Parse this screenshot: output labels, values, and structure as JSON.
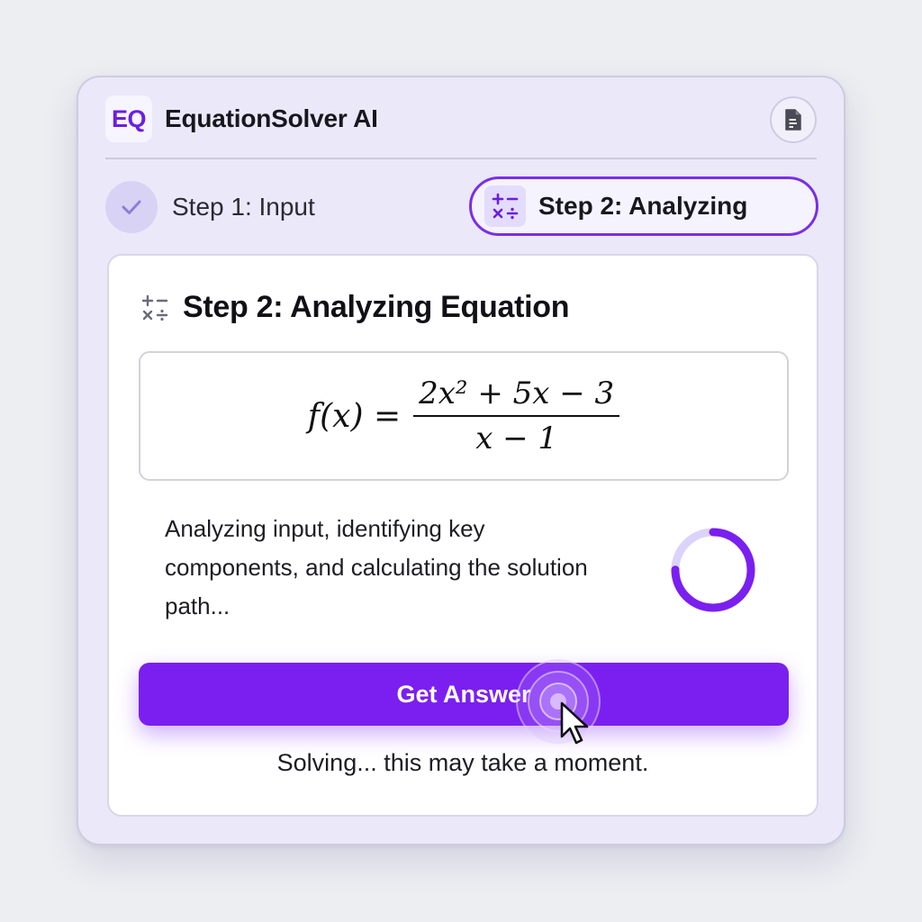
{
  "header": {
    "logo_text": "EQ",
    "title": "EquationSolver AI",
    "doc_icon": "document-icon"
  },
  "steps": [
    {
      "label": "Step 1: Input",
      "state": "completed",
      "icon": "check-icon"
    },
    {
      "label": "Step 2: Analyzing",
      "state": "active",
      "icon": "math-operators-icon"
    }
  ],
  "card": {
    "title": "Step 2: Analyzing Equation",
    "equation": {
      "lhs": "f(x) =",
      "numerator": "2x² + 5x − 3",
      "denominator": "x − 1"
    },
    "status_text": "Analyzing input, identifying key components, and calculating the solution path...",
    "progress_fraction": 0.75,
    "button_label": "Get Answer",
    "footer_text": "Solving... this may take a moment."
  },
  "colors": {
    "accent": "#7a1ff0",
    "accent_light": "#d8d2f5",
    "window_bg": "#ebe8fa"
  }
}
